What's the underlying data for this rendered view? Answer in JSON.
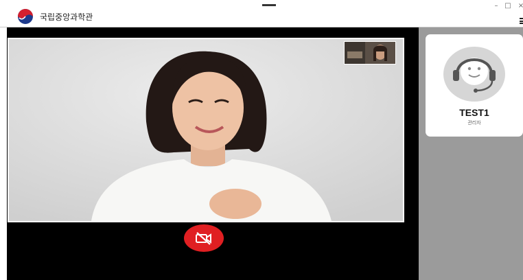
{
  "header": {
    "org_name": "국립중앙과학관",
    "logo_icon": "national-emblem-icon",
    "window_controls": {
      "minimize": "–",
      "maximize": "□",
      "close": "×"
    }
  },
  "video": {
    "main_feed": "remote-participant-video",
    "self_view": "local-camera-preview",
    "camera_button_icon": "camera-off-icon",
    "camera_button_color": "#e01f22"
  },
  "participant": {
    "name": "TEST1",
    "role": "관리자",
    "avatar_icon": "headset-agent-icon"
  },
  "colors": {
    "stage": "#000000",
    "side_panel": "#9b9b9b",
    "card": "#ffffff"
  }
}
